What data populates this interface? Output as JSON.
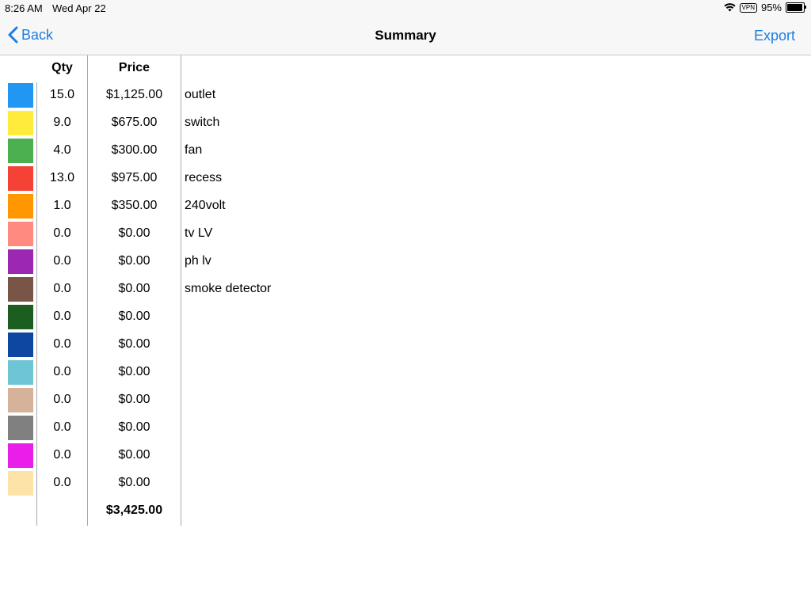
{
  "status_bar": {
    "time": "8:26 AM",
    "date": "Wed Apr 22",
    "vpn": "VPN",
    "battery_percent": "95%",
    "battery_level": 0.95
  },
  "nav": {
    "back_label": "Back",
    "title": "Summary",
    "export_label": "Export",
    "accent_color": "#1f7ee0"
  },
  "table": {
    "headers": {
      "qty": "Qty",
      "price": "Price"
    },
    "rows": [
      {
        "color": "#2196f3",
        "qty": "15.0",
        "price": "$1,125.00",
        "name": "outlet"
      },
      {
        "color": "#ffeb3b",
        "qty": "9.0",
        "price": "$675.00",
        "name": "switch"
      },
      {
        "color": "#4caf50",
        "qty": "4.0",
        "price": "$300.00",
        "name": "fan"
      },
      {
        "color": "#f44336",
        "qty": "13.0",
        "price": "$975.00",
        "name": "recess"
      },
      {
        "color": "#ff9800",
        "qty": "1.0",
        "price": "$350.00",
        "name": "240volt"
      },
      {
        "color": "#ff8a80",
        "qty": "0.0",
        "price": "$0.00",
        "name": "tv LV"
      },
      {
        "color": "#9c27b0",
        "qty": "0.0",
        "price": "$0.00",
        "name": "ph lv"
      },
      {
        "color": "#795548",
        "qty": "0.0",
        "price": "$0.00",
        "name": "smoke detector"
      },
      {
        "color": "#1b5e20",
        "qty": "0.0",
        "price": "$0.00",
        "name": ""
      },
      {
        "color": "#0d47a1",
        "qty": "0.0",
        "price": "$0.00",
        "name": ""
      },
      {
        "color": "#6ec6d4",
        "qty": "0.0",
        "price": "$0.00",
        "name": ""
      },
      {
        "color": "#d7b29a",
        "qty": "0.0",
        "price": "$0.00",
        "name": ""
      },
      {
        "color": "#808080",
        "qty": "0.0",
        "price": "$0.00",
        "name": ""
      },
      {
        "color": "#e91ee9",
        "qty": "0.0",
        "price": "$0.00",
        "name": ""
      },
      {
        "color": "#fde3a7",
        "qty": "0.0",
        "price": "$0.00",
        "name": ""
      }
    ],
    "total": "$3,425.00"
  }
}
